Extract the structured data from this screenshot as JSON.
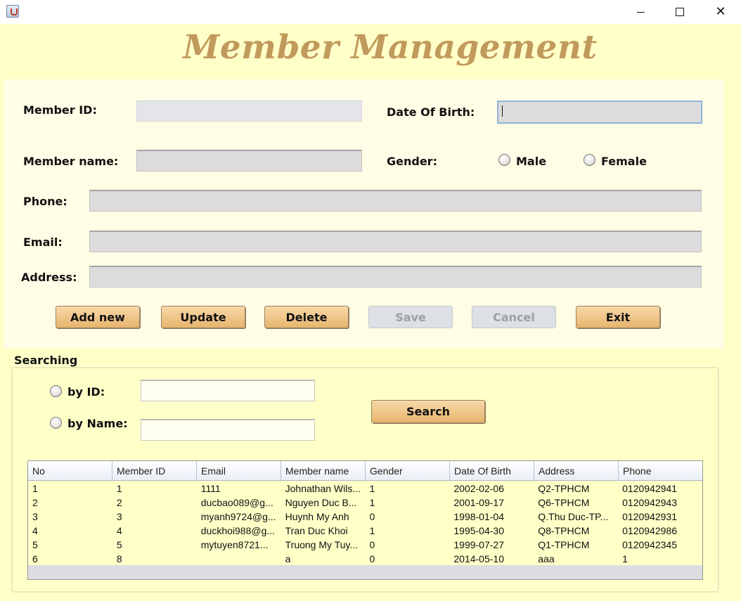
{
  "window": {
    "icon": "java-cup-icon",
    "controls": {
      "minimize": "minimize-icon",
      "maximize": "maximize-icon",
      "close": "close-icon",
      "close_glyph": "✕"
    }
  },
  "app": {
    "title": "Member Management"
  },
  "form": {
    "member_id": {
      "label": "Member ID:",
      "value": ""
    },
    "date_of_birth": {
      "label": "Date Of Birth:",
      "value": ""
    },
    "member_name": {
      "label": "Member name:",
      "value": ""
    },
    "gender": {
      "label": "Gender:",
      "options": [
        "Male",
        "Female"
      ],
      "selected": ""
    },
    "phone": {
      "label": "Phone:",
      "value": ""
    },
    "email": {
      "label": "Email:",
      "value": ""
    },
    "address": {
      "label": "Address:",
      "value": ""
    }
  },
  "actions": {
    "add_new": "Add new",
    "update": "Update",
    "delete": "Delete",
    "save": "Save",
    "cancel": "Cancel",
    "exit": "Exit"
  },
  "search": {
    "title": "Searching",
    "by_id_label": "by ID:",
    "by_name_label": "by Name:",
    "by_id_value": "",
    "by_name_value": "",
    "button": "Search"
  },
  "table": {
    "columns": [
      "No",
      "Member ID",
      "Email",
      "Member name",
      "Gender",
      "Date Of Birth",
      "Address",
      "Phone"
    ],
    "rows": [
      [
        "1",
        "1",
        "1111",
        "Johnathan Wils...",
        "1",
        "2002-02-06",
        "Q2-TPHCM",
        "0120942941"
      ],
      [
        "2",
        "2",
        "ducbao089@g...",
        "Nguyen Duc B...",
        "1",
        "2001-09-17",
        "Q6-TPHCM",
        "0120942943"
      ],
      [
        "3",
        "3",
        "myanh9724@g...",
        "Huynh My Anh",
        "0",
        "1998-01-04",
        "Q.Thu Duc-TP...",
        "0120942931"
      ],
      [
        "4",
        "4",
        "duckhoi988@g...",
        "Tran Duc Khoi",
        "1",
        "1995-04-30",
        "Q8-TPHCM",
        "0120942986"
      ],
      [
        "5",
        "5",
        "mytuyen8721...",
        "Truong My Tuy...",
        "0",
        "1999-07-27",
        "Q1-TPHCM",
        "0120942345"
      ],
      [
        "6",
        "8",
        "",
        "a",
        "0",
        "2014-05-10",
        "aaa",
        "1"
      ]
    ]
  },
  "colors": {
    "frame_background": "#ffffc8",
    "panel_background": "#fffde5",
    "title_color": "#c19a5b",
    "button_gradient_top": "#f8d9a8",
    "button_gradient_bottom": "#e7b46d"
  }
}
